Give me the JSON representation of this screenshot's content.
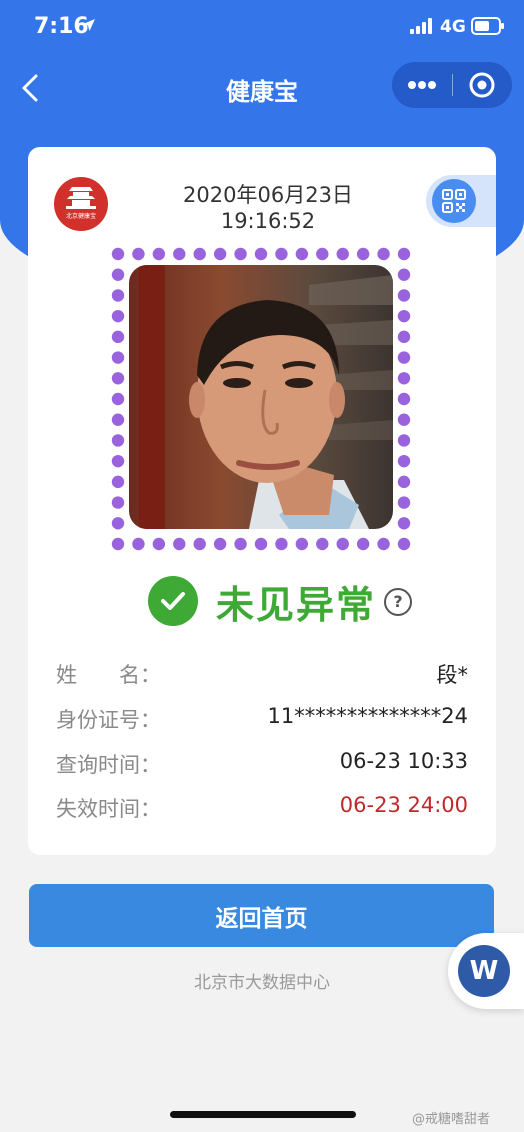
{
  "status_bar": {
    "time": "7:16",
    "network": "4G"
  },
  "nav": {
    "title": "健康宝"
  },
  "card": {
    "date": "2020年06月23日",
    "time": "19:16:52",
    "logo_text": "北京健康宝",
    "status": "未见异常",
    "help_symbol": "?",
    "rows": [
      {
        "label": "姓　　名：",
        "value": "段*"
      },
      {
        "label": "身份证号：",
        "value": "11**************24"
      },
      {
        "label": "查询时间：",
        "value": "06-23 10:33"
      },
      {
        "label": "失效时间：",
        "value": "06-23 24:00"
      }
    ]
  },
  "home_button": "返回首页",
  "footer": "北京市大数据中心",
  "float_button": "W",
  "watermark": "@戒糖嗜甜者",
  "colors": {
    "header_blue": "#3476ea",
    "status_green": "#3ea934",
    "expire_red": "#c0282a",
    "frame_dots": "#9a63de",
    "button_blue": "#3a89e0"
  },
  "icons": [
    "location-arrow-icon",
    "signal-icon",
    "battery-icon",
    "back-chevron-icon",
    "more-dots-icon",
    "close-target-icon",
    "qr-code-icon",
    "check-icon",
    "help-icon"
  ]
}
